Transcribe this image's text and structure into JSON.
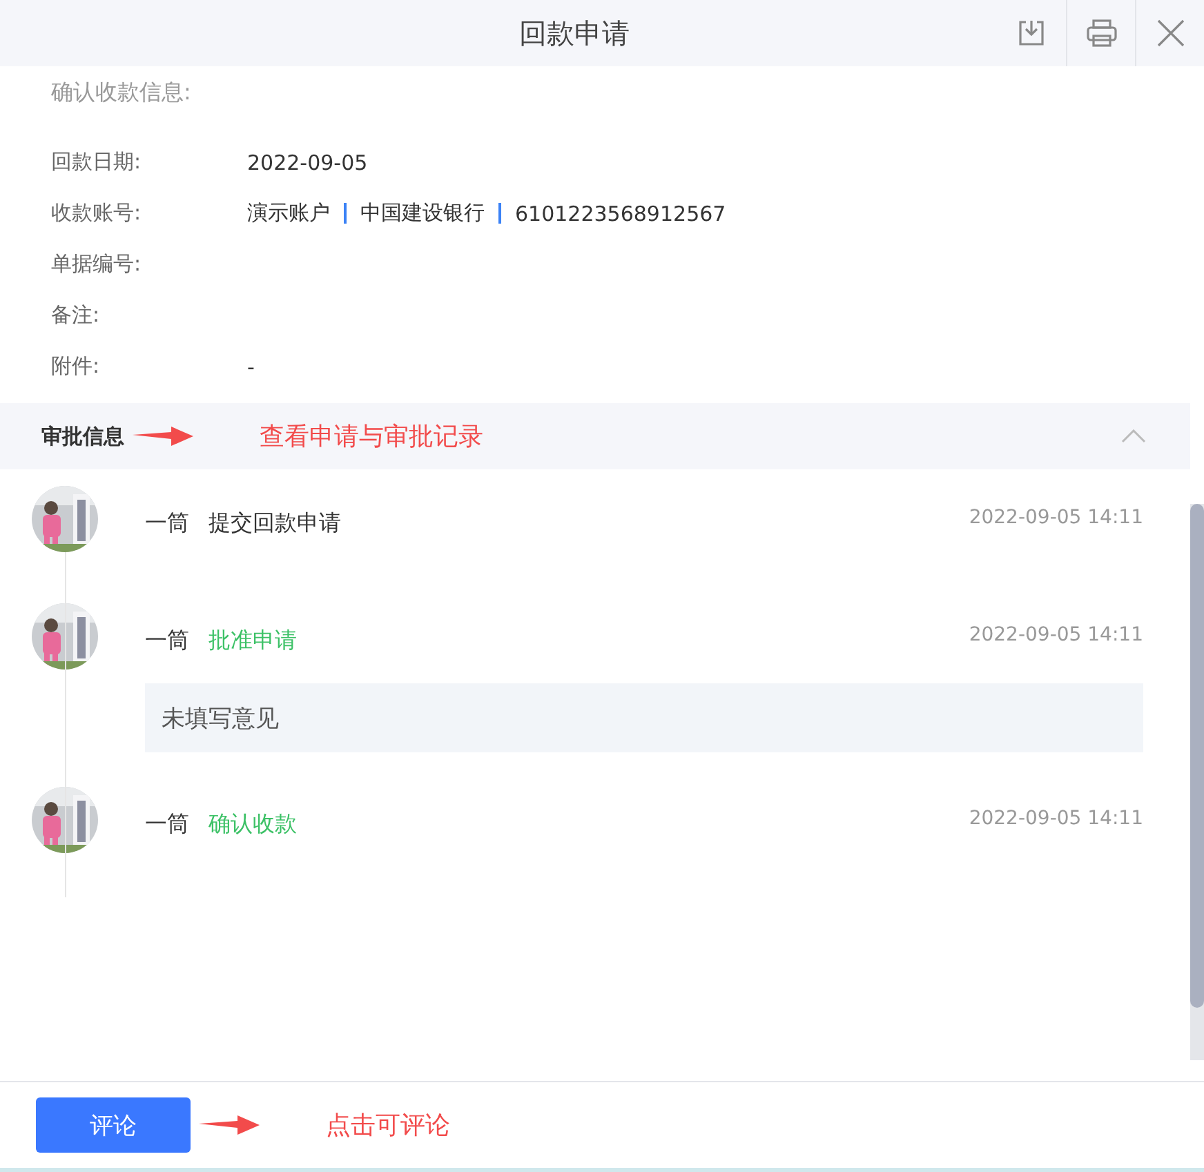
{
  "window": {
    "title": "回款申请"
  },
  "receipt": {
    "heading": "确认收款信息:",
    "fields": [
      {
        "kind": "text",
        "label": "回款日期:",
        "value": "2022-09-05"
      },
      {
        "kind": "account",
        "label": "收款账号:",
        "parts": [
          "演示账户",
          "中国建设银行",
          "6101223568912567"
        ]
      },
      {
        "kind": "text",
        "label": "单据编号:"
      },
      {
        "kind": "text",
        "label": "备注:"
      },
      {
        "kind": "text",
        "label": "附件:",
        "value": "-"
      }
    ]
  },
  "approval": {
    "title": "审批信息",
    "expanded": true,
    "annotation": "查看申请与审批记录",
    "records": [
      {
        "user": "一筒",
        "action": "提交回款申请",
        "kind": "plain",
        "time": "2022-09-05 14:11"
      },
      {
        "user": "一筒",
        "action": "批准申请",
        "kind": "success",
        "time": "2022-09-05 14:11",
        "comment": "未填写意见"
      },
      {
        "user": "一筒",
        "action": "确认收款",
        "kind": "success",
        "time": "2022-09-05 14:11"
      }
    ]
  },
  "footer": {
    "button": "评论",
    "annotation": "点击可评论"
  }
}
